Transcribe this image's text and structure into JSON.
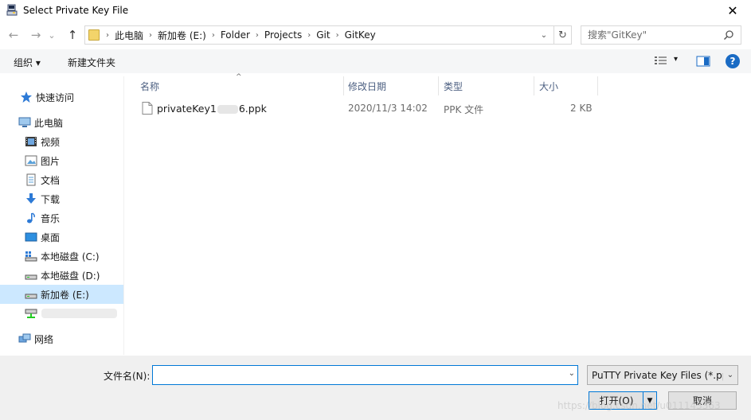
{
  "window": {
    "title": "Select Private Key File",
    "close_glyph": "✕"
  },
  "nav": {
    "back": "←",
    "forward": "→",
    "recent": "⌄",
    "up": "↑"
  },
  "address": {
    "breadcrumbs": [
      "此电脑",
      "新加卷 (E:)",
      "Folder",
      "Projects",
      "Git",
      "GitKey"
    ],
    "separator": "›",
    "refresh": "↻",
    "dropdown": "⌄"
  },
  "search": {
    "placeholder": "搜索\"GitKey\""
  },
  "toolbar": {
    "organize": "组织 ▾",
    "new_folder": "新建文件夹",
    "view_dd": "▾"
  },
  "sidebar": {
    "items": [
      {
        "label": "快速访问",
        "icon": "star-icon"
      },
      {
        "label": "此电脑",
        "icon": "computer-icon"
      },
      {
        "label": "视频",
        "icon": "video-icon"
      },
      {
        "label": "图片",
        "icon": "picture-icon"
      },
      {
        "label": "文档",
        "icon": "document-icon"
      },
      {
        "label": "下载",
        "icon": "download-icon"
      },
      {
        "label": "音乐",
        "icon": "music-icon"
      },
      {
        "label": "桌面",
        "icon": "desktop-icon"
      },
      {
        "label": "本地磁盘 (C:)",
        "icon": "drive-c-icon"
      },
      {
        "label": "本地磁盘 (D:)",
        "icon": "drive-icon"
      },
      {
        "label": "新加卷 (E:)",
        "icon": "drive-icon",
        "selected": true
      },
      {
        "label": "",
        "icon": "network-drive-icon"
      },
      {
        "label": "网络",
        "icon": "network-icon"
      }
    ]
  },
  "columns": {
    "name": "名称",
    "modified": "修改日期",
    "type": "类型",
    "size": "大小",
    "sort_glyph": "^"
  },
  "files": [
    {
      "name_prefix": "privateKey1",
      "name_suffix": "6.ppk",
      "modified": "2020/11/3 14:02",
      "type": "PPK 文件",
      "size": "2 KB"
    }
  ],
  "footer": {
    "filename_label": "文件名(N):",
    "filename_value": "",
    "filter": "PuTTY Private Key Files (*.pp",
    "open": "打开(O)",
    "cancel": "取消",
    "watermark": "https://blog.csdn.net/u011143363"
  },
  "colors": {
    "selected_bg": "#cce8ff",
    "accent": "#0078d7",
    "help": "#1a6bc4"
  }
}
